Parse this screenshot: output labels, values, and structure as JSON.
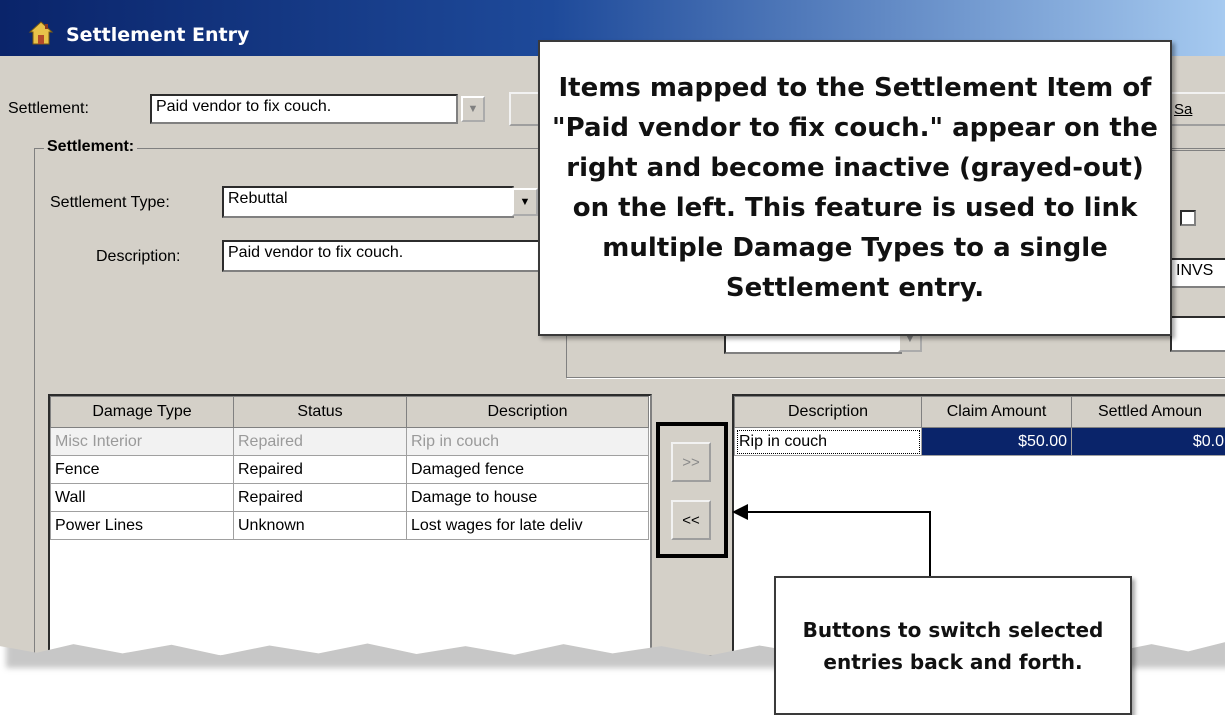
{
  "window": {
    "title": "Settlement Entry"
  },
  "header": {
    "settlement_label": "Settlement:",
    "settlement_value": "Paid vendor to fix couch.",
    "save_button_partial": "Sa"
  },
  "settlement_group": {
    "caption": "Settlement:",
    "type_label": "Settlement Type:",
    "type_value": "Rebuttal",
    "description_label": "Description:",
    "description_value": "Paid vendor to fix couch.",
    "partial_field_text": "INVS"
  },
  "left_grid": {
    "columns": [
      "Damage Type",
      "Status",
      "Description"
    ],
    "rows": [
      {
        "damage_type": "Misc Interior",
        "status": "Repaired",
        "description": "Rip in couch",
        "inactive": true
      },
      {
        "damage_type": "Fence",
        "status": "Repaired",
        "description": "Damaged fence",
        "inactive": false
      },
      {
        "damage_type": "Wall",
        "status": "Repaired",
        "description": "Damage to house",
        "inactive": false
      },
      {
        "damage_type": "Power Lines",
        "status": "Unknown",
        "description": "Lost wages for late deliv",
        "inactive": false
      }
    ]
  },
  "transfer_buttons": {
    "add": ">>",
    "remove": "<<"
  },
  "right_grid": {
    "columns": [
      "Description",
      "Claim Amount",
      "Settled Amoun"
    ],
    "rows": [
      {
        "description": "Rip in couch",
        "claim_amount": "$50.00",
        "settled_amount": "$0.0"
      }
    ]
  },
  "callouts": {
    "top": "Items mapped to the Settlement Item of \"Paid vendor to fix couch.\" appear on the right and become inactive (grayed-out) on the left.  This feature is used to link multiple Damage Types to a single Settlement entry.",
    "bottom": "Buttons to switch selected entries back and forth."
  }
}
